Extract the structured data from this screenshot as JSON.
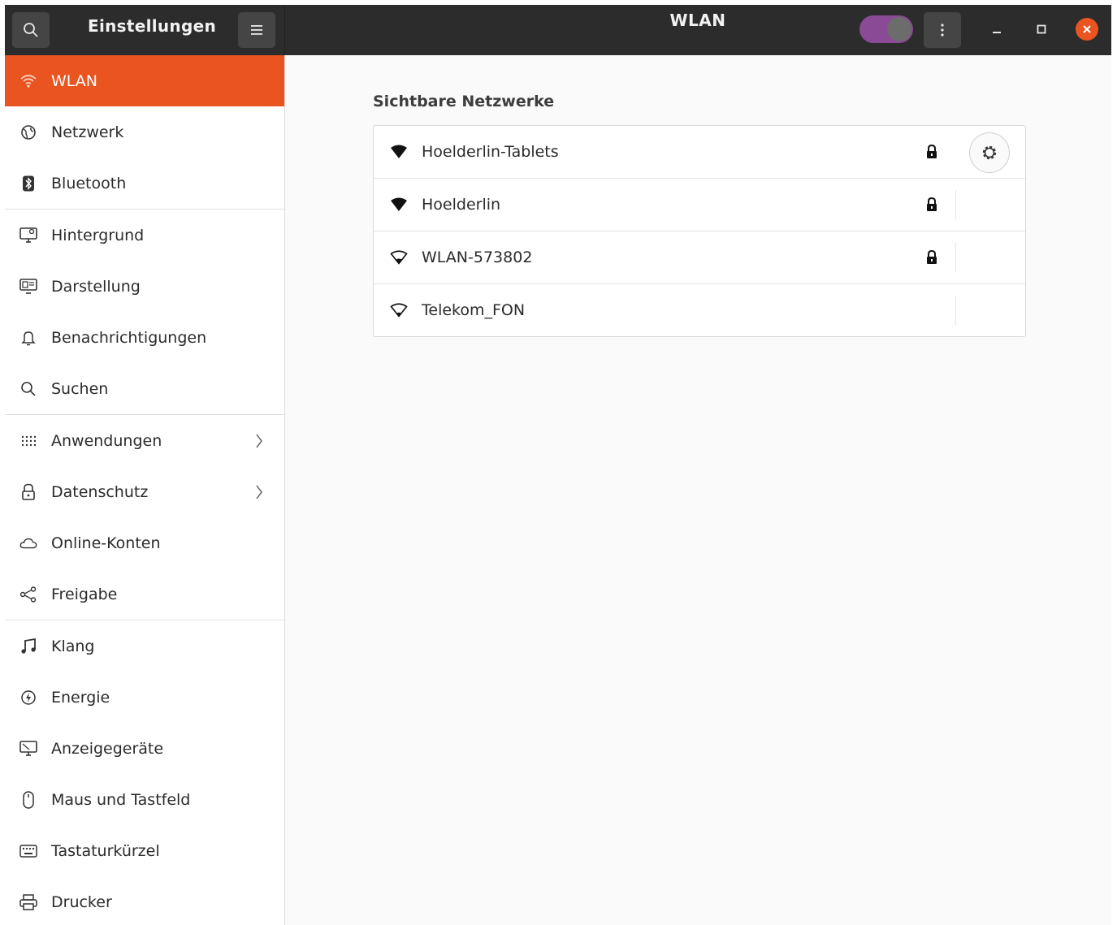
{
  "app": {
    "title": "Einstellungen",
    "page_title": "WLAN",
    "wifi_enabled": true,
    "accent_color": "#e95420",
    "toggle_color": "#8a4a95"
  },
  "titlebar": {
    "search_icon": "search-icon",
    "menu_icon": "hamburger-menu-icon",
    "more_icon": "vertical-dots-icon",
    "minimize_icon": "minimize-icon",
    "maximize_icon": "maximize-icon",
    "close_icon": "close-icon"
  },
  "sidebar": {
    "items": [
      {
        "label": "WLAN",
        "icon": "wifi-icon",
        "active": true
      },
      {
        "label": "Netzwerk",
        "icon": "network-globe-icon"
      },
      {
        "label": "Bluetooth",
        "icon": "bluetooth-icon"
      },
      {
        "label": "Hintergrund",
        "icon": "background-icon"
      },
      {
        "label": "Darstellung",
        "icon": "appearance-icon"
      },
      {
        "label": "Benachrichtigungen",
        "icon": "bell-icon"
      },
      {
        "label": "Suchen",
        "icon": "search-icon"
      },
      {
        "label": "Anwendungen",
        "icon": "apps-grid-icon",
        "chevron": true
      },
      {
        "label": "Datenschutz",
        "icon": "lock-icon",
        "chevron": true
      },
      {
        "label": "Online-Konten",
        "icon": "cloud-icon"
      },
      {
        "label": "Freigabe",
        "icon": "share-icon"
      },
      {
        "label": "Klang",
        "icon": "music-note-icon"
      },
      {
        "label": "Energie",
        "icon": "power-icon"
      },
      {
        "label": "Anzeigegeräte",
        "icon": "display-icon"
      },
      {
        "label": "Maus und Tastfeld",
        "icon": "mouse-icon"
      },
      {
        "label": "Tastaturkürzel",
        "icon": "keyboard-icon"
      },
      {
        "label": "Drucker",
        "icon": "printer-icon"
      }
    ]
  },
  "main": {
    "section_title": "Sichtbare Netzwerke",
    "networks": [
      {
        "name": "Hoelderlin-Tablets",
        "signal": "full",
        "secured": true,
        "connected": true
      },
      {
        "name": "Hoelderlin",
        "signal": "full",
        "secured": true,
        "connected": false
      },
      {
        "name": "WLAN-573802",
        "signal": "weak",
        "secured": true,
        "connected": false
      },
      {
        "name": "Telekom_FON",
        "signal": "weak",
        "secured": false,
        "connected": false
      }
    ]
  }
}
